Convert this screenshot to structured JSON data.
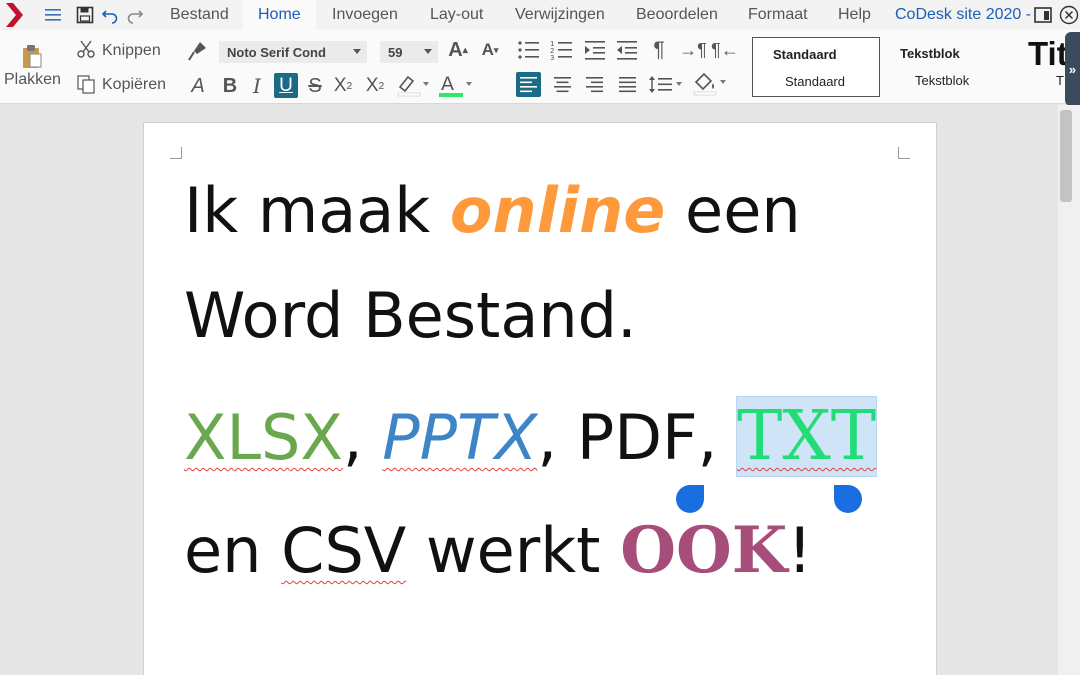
{
  "titlebar": {
    "tabs": [
      "Bestand",
      "Home",
      "Invoegen",
      "Lay-out",
      "Verwijzingen",
      "Beoordelen",
      "Formaat",
      "Help"
    ],
    "active_tab": "Home",
    "window_title": "CoDesk site 2020 -",
    "icons": [
      "app-logo-icon",
      "hamburger-icon",
      "save-icon",
      "undo-icon",
      "redo-icon",
      "layout-icon",
      "close-icon"
    ]
  },
  "ribbon": {
    "paste_label": "Plakken",
    "cut_label": "Knippen",
    "copy_label": "Kopiëren",
    "font_name": "Noto Serif Cond",
    "font_size": "59",
    "colors": {
      "highlight": "#ffffff",
      "font_color": "#2ee86a",
      "accent": "#1a5fb4",
      "active_button": "#1b6b86"
    },
    "styles": [
      {
        "name": "Standaard",
        "preview": "Standaard"
      },
      {
        "name": "Tekstblok",
        "preview": "Tekstblok"
      },
      {
        "name": "Tit",
        "preview": "T"
      }
    ],
    "expand_label": "»"
  },
  "document": {
    "line1": {
      "a": "Ik maak ",
      "b": "online",
      "c": " een"
    },
    "line2": "Word Bestand.",
    "line3": {
      "xlsx": "XLSX",
      "sep1": ", ",
      "pptx": "PPTX",
      "sep2": ", PDF, ",
      "txt": "TXT"
    },
    "line4": {
      "a": "en ",
      "b": "CSV",
      "c": " werkt ",
      "d": "OOK",
      "e": "!"
    },
    "colors": {
      "online": "#ff9a3c",
      "xlsx": "#6aa84f",
      "pptx": "#3d85c6",
      "txt": "#22dd77",
      "ook": "#a64d79",
      "selection": "#cfe4f7",
      "handle": "#1a6fe0"
    }
  }
}
